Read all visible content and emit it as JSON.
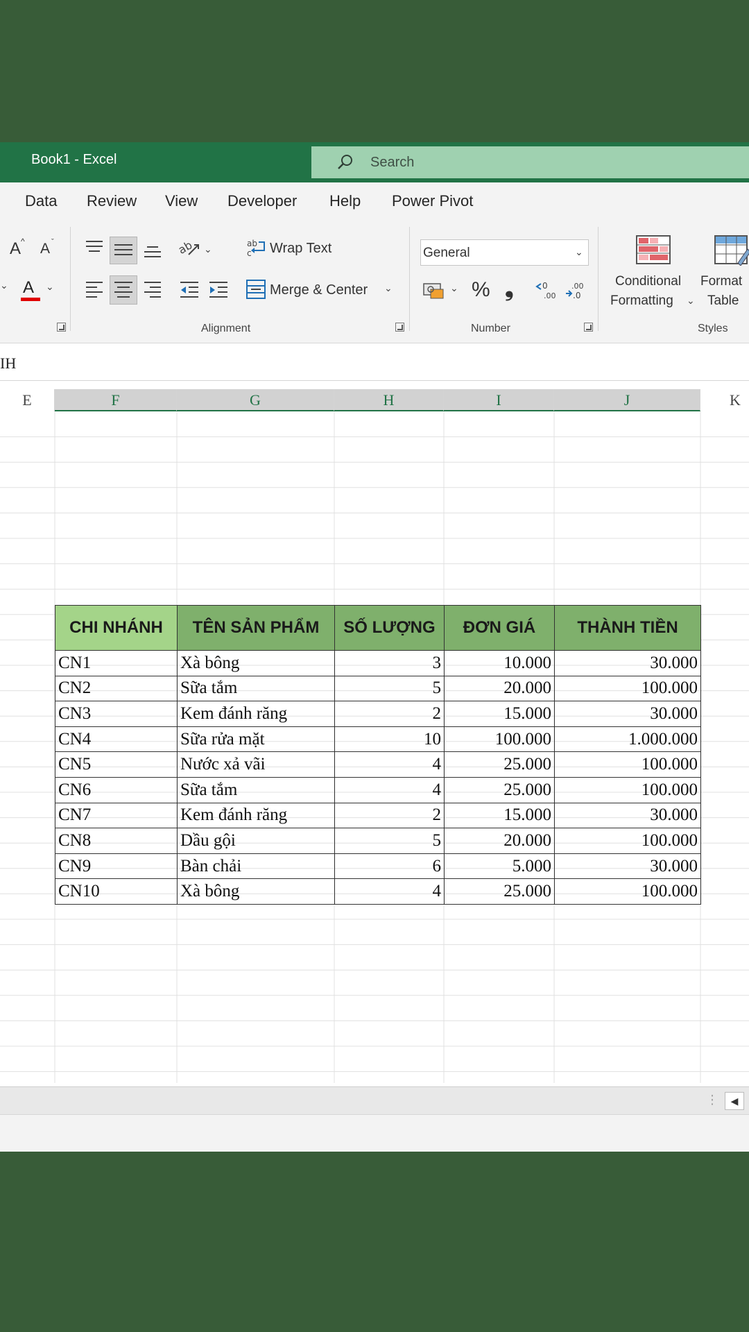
{
  "window": {
    "title": "Book1  -  Excel"
  },
  "search": {
    "label": "Search"
  },
  "menu": [
    "Data",
    "Review",
    "View",
    "Developer",
    "Help",
    "Power Pivot"
  ],
  "ribbon": {
    "wrap_text": "Wrap Text",
    "merge_center": "Merge & Center",
    "number_format": "General",
    "alignment_group": "Alignment",
    "number_group": "Number",
    "styles_group": "Styles",
    "conditional_formatting": [
      "Conditional",
      "Formatting"
    ],
    "format_table": [
      "Format",
      "Table"
    ],
    "font_grow": "A",
    "font_shrink": "A",
    "font_color": "A",
    "percent": "%",
    "comma": "❟"
  },
  "formula_bar": {
    "text": "IH"
  },
  "columns": [
    "E",
    "F",
    "G",
    "H",
    "I",
    "J",
    "K"
  ],
  "table": {
    "headers": [
      "CHI NHÁNH",
      "TÊN SẢN PHẨM",
      "SỐ LƯỢNG",
      "ĐƠN GIÁ",
      "THÀNH TIỀN"
    ],
    "rows": [
      [
        "CN1",
        "Xà bông",
        "3",
        "10.000",
        "30.000"
      ],
      [
        "CN2",
        "Sữa tắm",
        "5",
        "20.000",
        "100.000"
      ],
      [
        "CN3",
        "Kem đánh răng",
        "2",
        "15.000",
        "30.000"
      ],
      [
        "CN4",
        "Sữa rửa mặt",
        "10",
        "100.000",
        "1.000.000"
      ],
      [
        "CN5",
        "Nước xả vãi",
        "4",
        "25.000",
        "100.000"
      ],
      [
        "CN6",
        "Sữa tắm",
        "4",
        "25.000",
        "100.000"
      ],
      [
        "CN7",
        "Kem đánh răng",
        "2",
        "15.000",
        "30.000"
      ],
      [
        "CN8",
        "Dầu gội",
        "5",
        "20.000",
        "100.000"
      ],
      [
        "CN9",
        "Bàn chải",
        "6",
        "5.000",
        "30.000"
      ],
      [
        "CN10",
        "Xà bông",
        "4",
        "25.000",
        "100.000"
      ]
    ]
  },
  "colors": {
    "excel_green": "#217346",
    "header_fill": "#7fb06c",
    "header_first_fill": "#a4d489",
    "background": "#385c38"
  }
}
